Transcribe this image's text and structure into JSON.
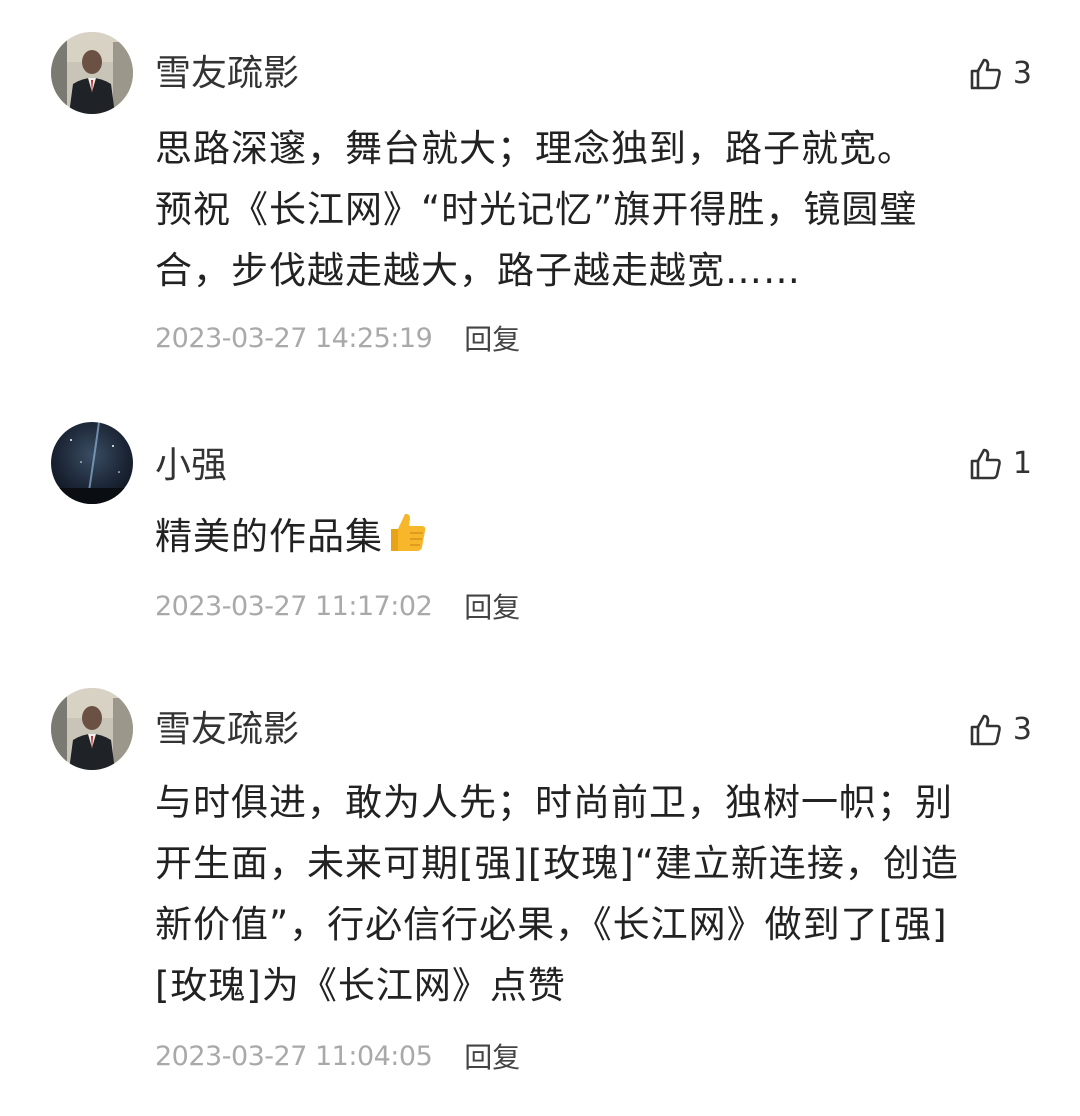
{
  "comments": [
    {
      "user": "雪友疏影",
      "likes": "3",
      "lines": [
        "思路深邃，舞台就大；理念独到，路子就宽。",
        "预祝《长江网》“时光记忆”旗开得胜，镜圆璧",
        "合，步伐越走越大，路子越走越宽……"
      ],
      "time": "2023-03-27 14:25:19",
      "reply_label": "回复",
      "avatar": "man-in-suit-photo"
    },
    {
      "user": "小强",
      "likes": "1",
      "lines": [
        "精美的作品集"
      ],
      "emoji": "thumbs-up-emoji",
      "time": "2023-03-27 11:17:02",
      "reply_label": "回复",
      "avatar": "night-sky-photo"
    },
    {
      "user": "雪友疏影",
      "likes": "3",
      "lines": [
        "与时俱进，敢为人先；时尚前卫，独树一帜；别",
        "开生面，未来可期[强][玫瑰]“建立新连接，创造",
        "新价值”，行必信行必果，《长江网》做到了[强]",
        "[玫瑰]为《长江网》点赞"
      ],
      "time": "2023-03-27 11:04:05",
      "reply_label": "回复",
      "avatar": "man-in-suit-photo"
    }
  ],
  "icons": {
    "like": "thumbs-up-outline-icon"
  },
  "colors": {
    "background": "#ffffff",
    "timestamp": "#a9a9a9",
    "text": "#222222"
  }
}
